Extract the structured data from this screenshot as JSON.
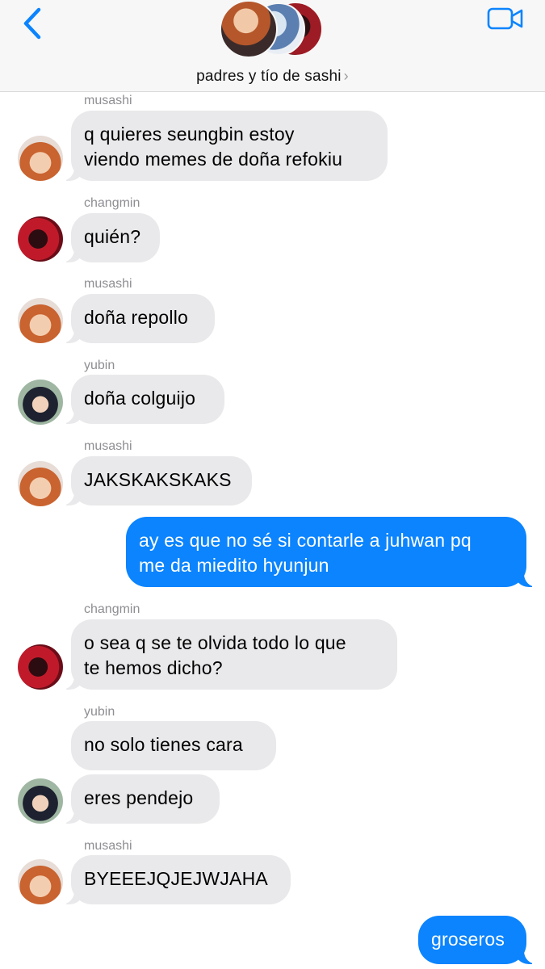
{
  "header": {
    "back_icon": "chevron-left-icon",
    "video_icon": "video-camera-icon",
    "group_name": "padres y tío de sashi",
    "chevron": "›",
    "accent_color": "#0b84fe"
  },
  "messages": [
    {
      "sender": "musashi",
      "text": [
        "q quieres seungbin estoy",
        "viendo memes de doña refokiu"
      ]
    },
    {
      "sender": "changmin",
      "text": [
        "quién?"
      ]
    },
    {
      "sender": "musashi",
      "text": [
        "doña repollo"
      ]
    },
    {
      "sender": "yubin",
      "text": [
        "doña colguijo"
      ]
    },
    {
      "sender": "musashi",
      "text": [
        "JAKSKAKSKAKS"
      ]
    },
    {
      "sender": "me",
      "text": [
        "ay es que no sé si contarle a juhwan pq",
        "me da miedito hyunjun"
      ]
    },
    {
      "sender": "changmin",
      "text": [
        "o sea q se te olvida todo lo que",
        "te hemos dicho?"
      ]
    },
    {
      "sender": "yubin",
      "text": [
        "no solo tienes cara"
      ]
    },
    {
      "sender": "yubin",
      "text": [
        "eres pendejo"
      ]
    },
    {
      "sender": "musashi",
      "text": [
        "BYEEEJQJEJWJAHA"
      ]
    },
    {
      "sender": "me",
      "text": [
        "groseros"
      ]
    }
  ]
}
